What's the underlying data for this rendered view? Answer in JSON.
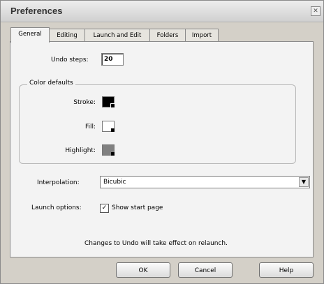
{
  "window": {
    "title": "Preferences"
  },
  "tabs": [
    {
      "label": "General",
      "active": true
    },
    {
      "label": "Editing",
      "active": false
    },
    {
      "label": "Launch and Edit",
      "active": false
    },
    {
      "label": "Folders",
      "active": false
    },
    {
      "label": "Import",
      "active": false
    }
  ],
  "general": {
    "undo_label": "Undo steps:",
    "undo_value": "20",
    "color_group_label": "Color defaults",
    "colors": [
      {
        "label": "Stroke:",
        "color": "#000000"
      },
      {
        "label": "Fill:",
        "color": "#ffffff"
      },
      {
        "label": "Highlight:",
        "color": "#808080"
      }
    ],
    "interpolation_label": "Interpolation:",
    "interpolation_value": "Bicubic",
    "launch_label": "Launch options:",
    "show_start_page_label": "Show start page",
    "show_start_page_checked": true,
    "info_text": "Changes to Undo will take effect on relaunch."
  },
  "buttons": {
    "ok": "OK",
    "cancel": "Cancel",
    "help": "Help"
  }
}
